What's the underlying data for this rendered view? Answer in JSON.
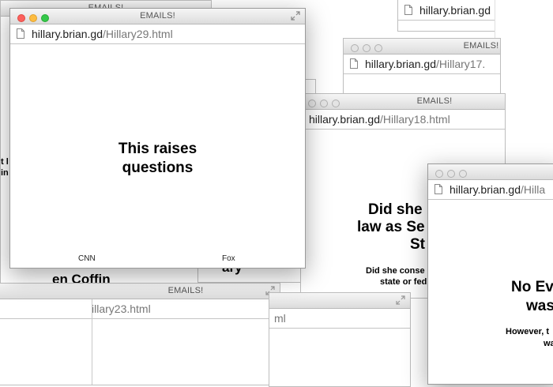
{
  "windows": {
    "main": {
      "title": "EMAILS!",
      "url_host": "hillary.brian.gd",
      "url_path": "/Hillary29.html",
      "headline_line1": "This raises",
      "headline_line2": "questions",
      "left_link": "CNN",
      "right_link": "Fox"
    },
    "w17": {
      "title": "EMAILS!",
      "url_host": "hillary.brian.gd",
      "url_path": "/Hillary17."
    },
    "w18": {
      "title": "EMAILS!",
      "url_host": "hillary.brian.gd",
      "url_path": "/Hillary18.html",
      "headline_1": "Did she",
      "headline_2": "law as Se",
      "headline_3": "St",
      "sub_1": "Did she conse",
      "sub_2": "state or fed"
    },
    "top": {
      "url_host": "hillary.brian.gd"
    },
    "right": {
      "url_host": "hillary.brian.gd",
      "url_path": "/Hilla",
      "headline_1": "No Ev",
      "headline_2": "was",
      "sub_1": "However, t",
      "sub_2": "wa"
    },
    "w23": {
      "title": "EMAILS!",
      "url_path": "illary23.html"
    },
    "bottom_mid": {
      "url_path": "ml"
    },
    "behind_left": {
      "title": "EMAILS!",
      "text_1": "t l",
      "text_2": "in"
    },
    "behind_mid": {
      "text_1": "ary",
      "text_2": "en Coffin"
    }
  }
}
